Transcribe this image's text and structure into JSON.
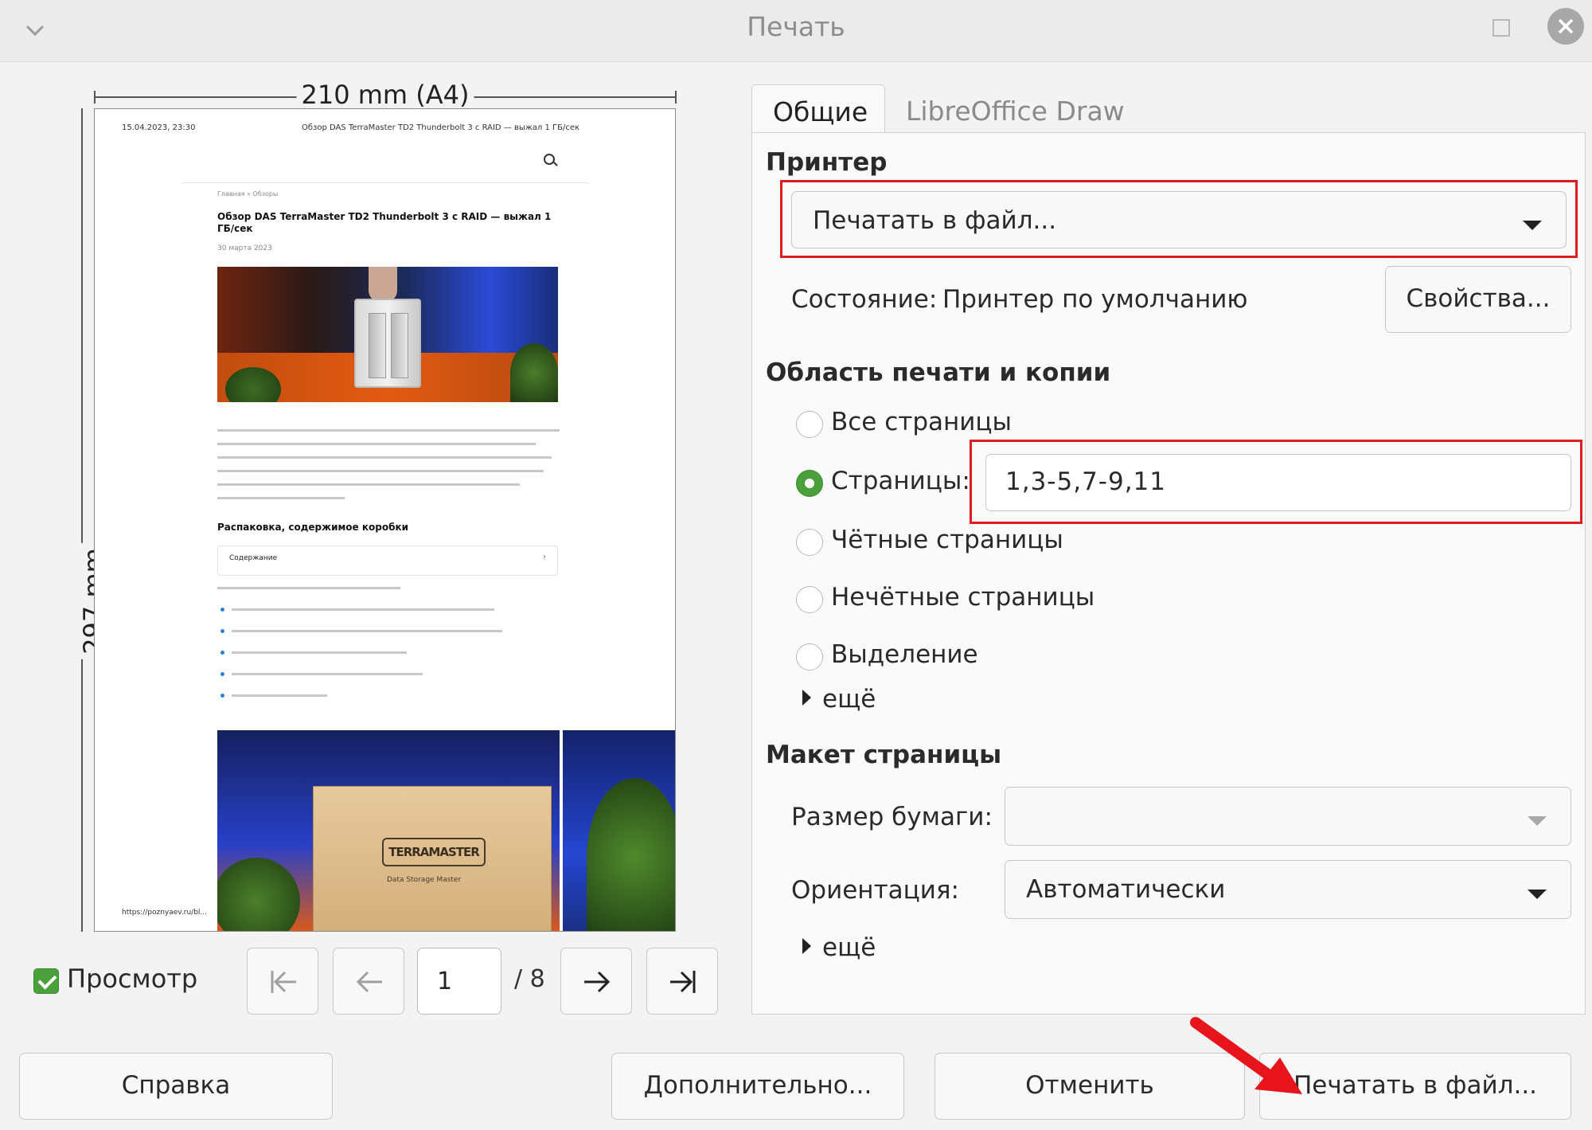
{
  "window": {
    "title": "Печать"
  },
  "preview": {
    "width_label": "210 mm (A4)",
    "height_label": "297 mm",
    "page": {
      "date": "15.04.2023, 23:30",
      "header": "Обзор DAS TerraMaster TD2 Thunderbolt 3 с RAID — выжал 1 ГБ/сек",
      "breadcrumb": "Главная » Обзоры",
      "title": "Обзор DAS TerraMaster TD2 Thunderbolt 3 с RAID — выжал 1 ГБ/сек",
      "date2": "30 марта 2023",
      "h2": "Распаковка, содержимое коробки",
      "toc": "Содержание",
      "logo": "TERRAMASTER",
      "logo_tagline": "Data Storage Master",
      "url": "https://poznyaev.ru/bl..."
    },
    "preview_checkbox": {
      "label": "Просмотр",
      "checked": true
    },
    "current_page": "1",
    "total_pages": "/ 8"
  },
  "tabs": [
    {
      "label": "Общие",
      "active": true
    },
    {
      "label": "LibreOffice Draw",
      "active": false
    }
  ],
  "printer": {
    "heading": "Принтер",
    "selected": "Печатать в файл...",
    "status_label": "Состояние:",
    "status_value": "Принтер по умолчанию",
    "properties_button": "Свойства..."
  },
  "range": {
    "heading": "Область печати и копии",
    "options": [
      {
        "label": "Все страницы",
        "selected": false
      },
      {
        "label": "Страницы:",
        "selected": true
      },
      {
        "label": "Чётные страницы",
        "selected": false
      },
      {
        "label": "Нечётные страницы",
        "selected": false
      },
      {
        "label": "Выделение",
        "selected": false
      }
    ],
    "pages_value": "1,3-5,7-9,11",
    "more": "ещё"
  },
  "layout": {
    "heading": "Макет страницы",
    "paper_size_label": "Размер бумаги:",
    "paper_size_value": "",
    "orientation_label": "Ориентация:",
    "orientation_value": "Автоматически",
    "more": "ещё"
  },
  "buttons": {
    "help": "Справка",
    "advanced": "Дополнительно...",
    "cancel": "Отменить",
    "print": "Печатать в файл..."
  },
  "colors": {
    "highlight": "#e01b22",
    "accent": "#4aa13b",
    "arrow": "#e8141c"
  }
}
